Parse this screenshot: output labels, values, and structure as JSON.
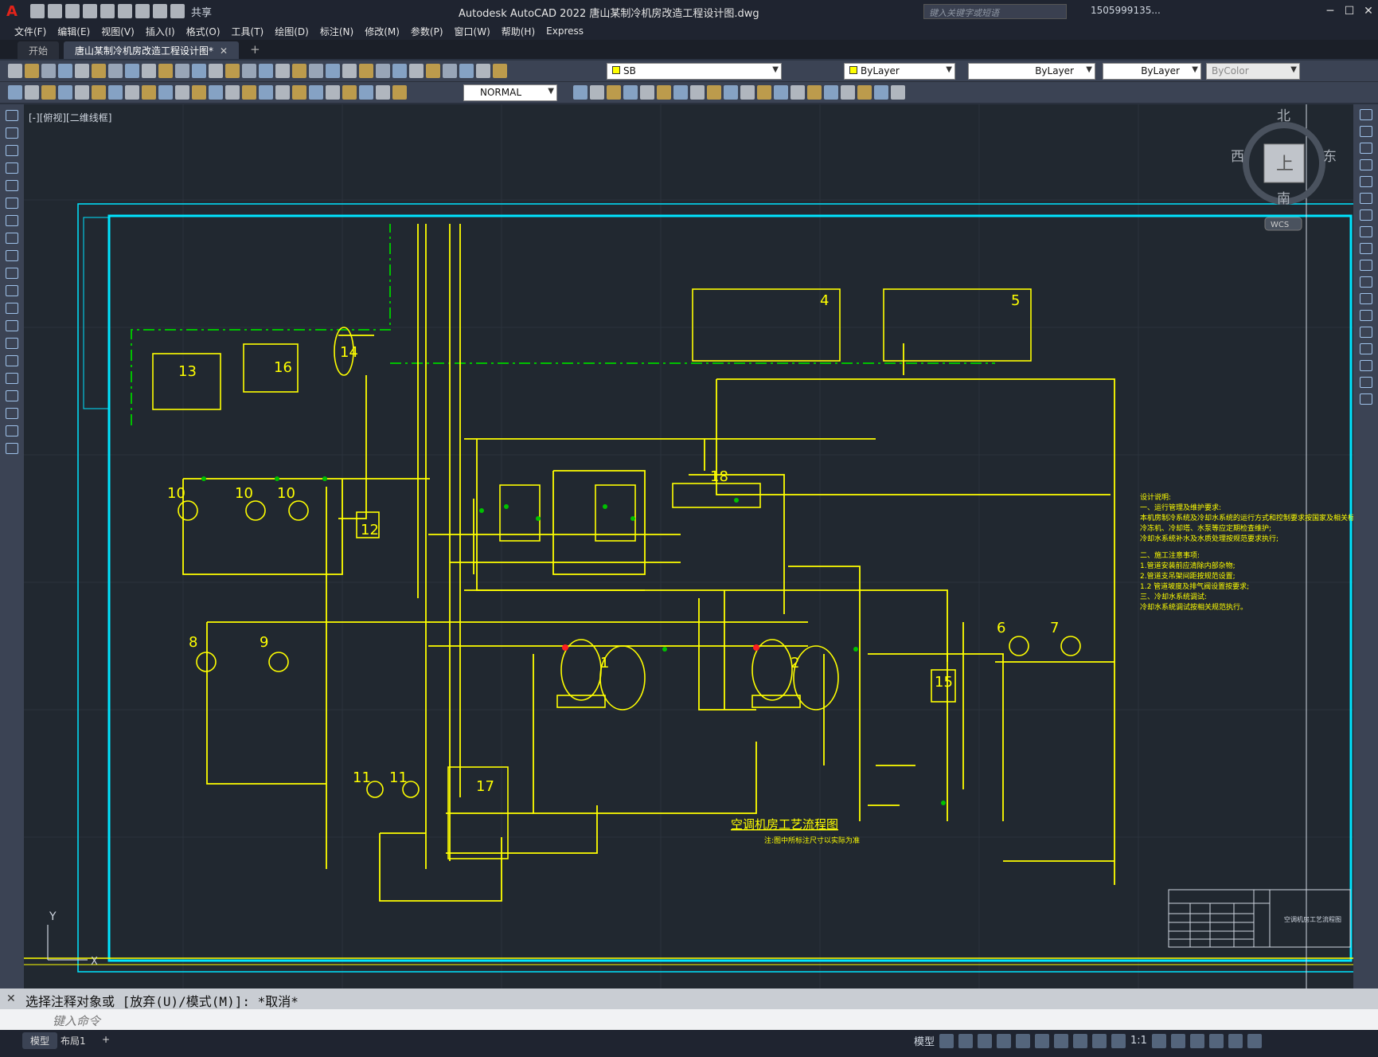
{
  "app": {
    "title": "Autodesk AutoCAD 2022    唐山某制冷机房改造工程设计图.dwg",
    "share_label": "共享",
    "search_placeholder": "键入关键字或短语",
    "user": "1505999135...",
    "logo": "A"
  },
  "menu": [
    "文件(F)",
    "编辑(E)",
    "视图(V)",
    "插入(I)",
    "格式(O)",
    "工具(T)",
    "绘图(D)",
    "标注(N)",
    "修改(M)",
    "参数(P)",
    "窗口(W)",
    "帮助(H)",
    "Express"
  ],
  "tabs": {
    "start": "开始",
    "active": "唐山某制冷机房改造工程设计图*"
  },
  "toolbar": {
    "layer": "SB",
    "color": "ByLayer",
    "linetype": "ByLayer",
    "lineweight": "ByLayer",
    "plotstyle": "ByColor",
    "textstyle": "NORMAL"
  },
  "viewport": {
    "label": "[-][俯视][二维线框]",
    "compass": {
      "n": "北",
      "s": "南",
      "e": "东",
      "w": "西",
      "top": "上",
      "wcs": "WCS"
    }
  },
  "drawing": {
    "title": "空调机房工艺流程图",
    "subtitle": "注:图中所标注尺寸以实际为准",
    "equipment": [
      "1",
      "2",
      "4",
      "5",
      "6",
      "7",
      "8",
      "9",
      "10",
      "10",
      "10",
      "11",
      "11",
      "12",
      "13",
      "14",
      "15",
      "16",
      "17",
      "18"
    ],
    "notes_title": "设计说明:",
    "notes": [
      "一、运行管理及维护要求:",
      "本机房制冷系统及冷却水系统的运行方式和控制要求按国家及相关标准执行;",
      "冷冻机、冷却塔、水泵等应定期检查维护;",
      "冷却水系统补水及水质处理按规范要求执行;",
      "二、施工注意事项:",
      "1.管道安装前应清除内部杂物;",
      "2.管道支吊架间距按规范设置;",
      "1.2 管道坡度及排气阀设置按要求;",
      "三、冷却水系统调试:",
      "冷却水系统调试按相关规范执行。"
    ],
    "titleblock": "空调机房工艺流程图"
  },
  "command": {
    "history": "选择注释对象或 [放弃(U)/模式(M)]: *取消*",
    "placeholder": "键入命令"
  },
  "status": {
    "model_tab": "模型",
    "layout_tab": "布局1",
    "model_label": "模型",
    "scale": "1:1"
  },
  "colors": {
    "drawing_line": "#ffff00",
    "border": "#00e5ff",
    "valve": "#00c000",
    "canvas_bg": "#212830"
  }
}
